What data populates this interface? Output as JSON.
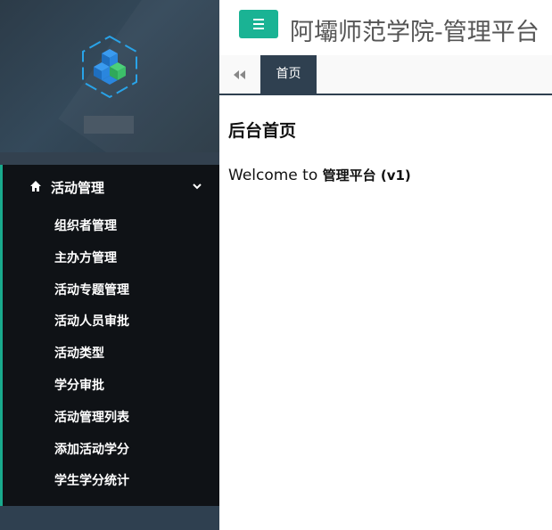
{
  "app": {
    "title": "阿壩师范学院-管理平台"
  },
  "sidebar": {
    "section": {
      "label": "活动管理",
      "icon": "home-icon"
    },
    "items": [
      {
        "label": "组织者管理"
      },
      {
        "label": "主办方管理"
      },
      {
        "label": "活动专题管理"
      },
      {
        "label": "活动人员审批"
      },
      {
        "label": "活动类型"
      },
      {
        "label": "学分审批"
      },
      {
        "label": "活动管理列表"
      },
      {
        "label": "添加活动学分"
      },
      {
        "label": "学生学分统计"
      }
    ]
  },
  "tabs": {
    "active_label": "首页"
  },
  "content": {
    "title": "后台首页",
    "welcome_text": "Welcome to ",
    "welcome_strong": "管理平台 (v1)"
  },
  "colors": {
    "accent": "#1ab394",
    "sidebar": "#2f4050",
    "menu_bg": "#0f1216"
  }
}
